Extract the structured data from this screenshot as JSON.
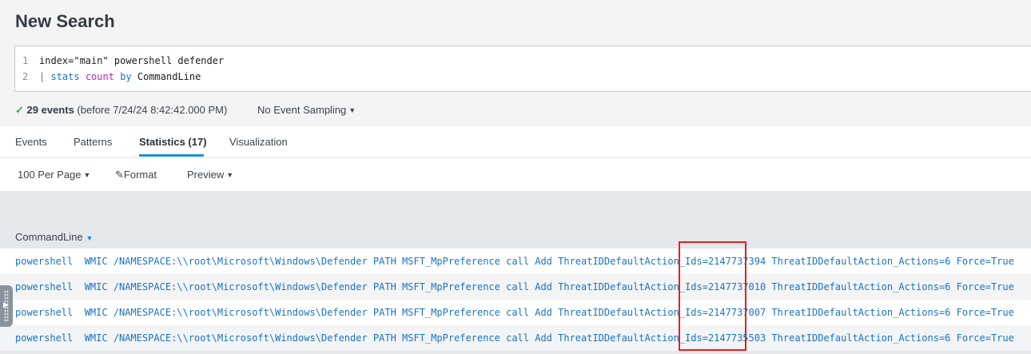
{
  "page": {
    "title": "New Search"
  },
  "editor": {
    "line_numbers": [
      "1",
      "2"
    ],
    "line1": "index=\"main\" powershell defender",
    "line2": {
      "pipe": "|",
      "command": "stats",
      "function": "count",
      "operator": "by",
      "field": "CommandLine"
    }
  },
  "status": {
    "check": "✓",
    "count": "29 events",
    "detail": "(before 7/24/24 8:42:42.000 PM)",
    "sampling": "No Event Sampling"
  },
  "tabs": [
    {
      "label": "Events"
    },
    {
      "label": "Patterns"
    },
    {
      "label": "Statistics (17)",
      "active": true
    },
    {
      "label": "Visualization"
    }
  ],
  "toolbar": {
    "per_page": "100 Per Page",
    "format": "Format",
    "preview": "Preview"
  },
  "table": {
    "column": "CommandLine",
    "rows": [
      "powershell  WMIC /NAMESPACE:\\\\root\\Microsoft\\Windows\\Defender PATH MSFT_MpPreference call Add ThreatIDDefaultAction_Ids=2147737394 ThreatIDDefaultAction_Actions=6 Force=True",
      "powershell  WMIC /NAMESPACE:\\\\root\\Microsoft\\Windows\\Defender PATH MSFT_MpPreference call Add ThreatIDDefaultAction_Ids=2147737010 ThreatIDDefaultAction_Actions=6 Force=True",
      "powershell  WMIC /NAMESPACE:\\\\root\\Microsoft\\Windows\\Defender PATH MSFT_MpPreference call Add ThreatIDDefaultAction_Ids=2147737007 ThreatIDDefaultAction_Actions=6 Force=True",
      "powershell  WMIC /NAMESPACE:\\\\root\\Microsoft\\Windows\\Defender PATH MSFT_MpPreference call Add ThreatIDDefaultAction_Ids=2147735503 ThreatIDDefaultAction_Actions=6 Force=True"
    ]
  },
  "colors": {
    "accent": "#1a8fd1",
    "link": "#1b73c2",
    "highlight": "#e0221f",
    "success": "#3aa553"
  }
}
